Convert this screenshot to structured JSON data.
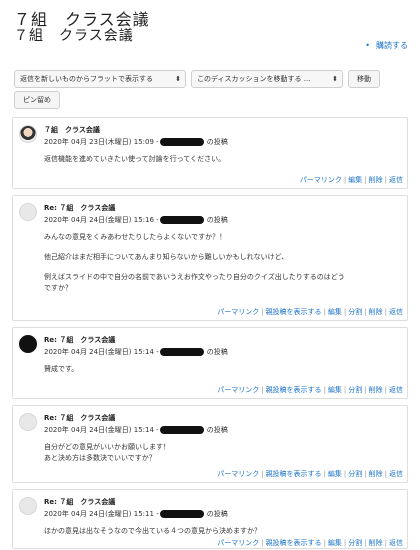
{
  "page": {
    "title": "７組　クラス会議",
    "subtitle": "７組　クラス会議",
    "subscribe": "購読する"
  },
  "controls": {
    "display_mode": "返信を新しいものからフラットで表示する",
    "move_discussion": "このディスカッションを移動する ...",
    "move_button": "移動",
    "pin_button": "ピン留め"
  },
  "posts": [
    {
      "subject": "７組　クラス会議",
      "date": "2020年 04月 23日(木曜日) 15:09 -",
      "suffix": "の投稿",
      "body": [
        "返信機能を進めていきたい使って討論を行ってください。"
      ],
      "commands": [
        "パーマリンク",
        "編集",
        "削除",
        "返信"
      ]
    },
    {
      "subject": "Re: ７組　クラス会議",
      "date": "2020年 04月 24日(金曜日) 15:16 -",
      "suffix": "の投稿",
      "body": [
        "みんなの意見をくみあわせたりしたらよくないですか？！",
        "他己紹介はまだ相手についてあんまり知らないから難しいかもしれないけど、",
        "例えばスライドの中で自分の名前であいうえお作文やったり自分のクイズ出したりするのはどう",
        "ですか？"
      ],
      "commands": [
        "パーマリンク",
        "親投稿を表示する",
        "編集",
        "分割",
        "削除",
        "返信"
      ]
    },
    {
      "subject": "Re: ７組　クラス会議",
      "date": "2020年 04月 24日(金曜日) 15:14 -",
      "suffix": "の投稿",
      "body": [
        "賛成です。"
      ],
      "commands": [
        "パーマリンク",
        "親投稿を表示する",
        "編集",
        "分割",
        "削除",
        "返信"
      ]
    },
    {
      "subject": "Re: ７組　クラス会議",
      "date": "2020年 04月 24日(金曜日) 15:14 -",
      "suffix": "の投稿",
      "body": [
        "自分がどの意見がいいかお願いします！",
        "あと決め方は多数決でいいですか？"
      ],
      "commands": [
        "パーマリンク",
        "親投稿を表示する",
        "編集",
        "分割",
        "削除",
        "返信"
      ]
    },
    {
      "subject": "Re: ７組　クラス会議",
      "date": "2020年 04月 24日(金曜日) 15:11 -",
      "suffix": "の投稿",
      "body": [
        "ほかの意見は出なそうなので今出ている４つの意見から決めますか？"
      ],
      "commands": [
        "パーマリンク",
        "親投稿を表示する",
        "編集",
        "分割",
        "削除",
        "返信"
      ]
    }
  ],
  "colors": {
    "link": "#1a73c9",
    "border": "#dedede",
    "redaction": "#111111"
  }
}
